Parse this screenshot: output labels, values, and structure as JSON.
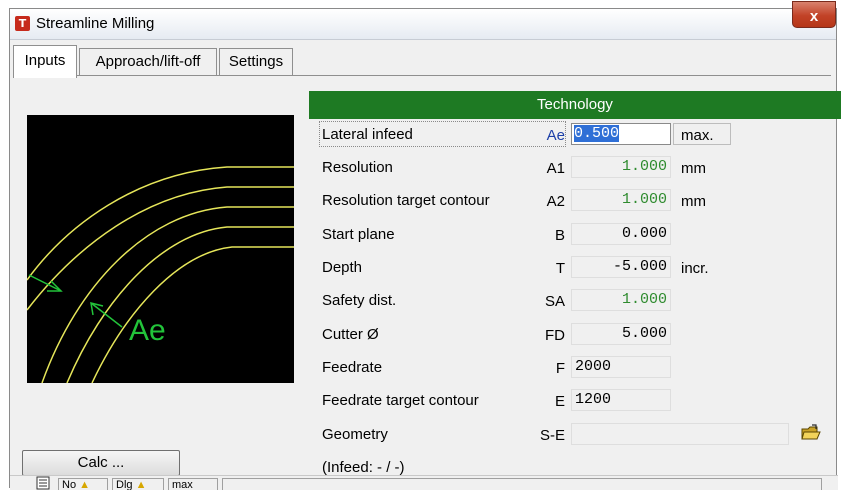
{
  "window": {
    "title": "Streamline Milling",
    "close_label": "x"
  },
  "tabs": [
    {
      "label": "Inputs",
      "active": true
    },
    {
      "label": "Approach/lift-off",
      "active": false
    },
    {
      "label": "Settings",
      "active": false
    }
  ],
  "preview": {
    "label": "Ae"
  },
  "calc_button": "Calc ...",
  "technology": {
    "header": "Technology",
    "rows": [
      {
        "label": "Lateral infeed",
        "symbol": "Ae",
        "value": "0.500",
        "unit": "max."
      },
      {
        "label": "Resolution",
        "symbol": "A1",
        "value": "1.000",
        "unit": "mm"
      },
      {
        "label": "Resolution target contour",
        "symbol": "A2",
        "value": "1.000",
        "unit": "mm"
      },
      {
        "label": "Start plane",
        "symbol": "B",
        "value": "0.000",
        "unit": ""
      },
      {
        "label": "Depth",
        "symbol": "T",
        "value": "-5.000",
        "unit": "incr."
      },
      {
        "label": "Safety dist.",
        "symbol": "SA",
        "value": "1.000",
        "unit": ""
      },
      {
        "label": "Cutter Ø",
        "symbol": "FD",
        "value": "5.000",
        "unit": ""
      },
      {
        "label": "Feedrate",
        "symbol": "F",
        "value": "2000",
        "unit": ""
      },
      {
        "label": "Feedrate target contour",
        "symbol": "E",
        "value": "1200",
        "unit": ""
      },
      {
        "label": "Geometry",
        "symbol": "S-E",
        "value": "",
        "unit": ""
      }
    ],
    "infeed_note": "(Infeed: - / -)"
  },
  "statusbar": {
    "items": [
      "No",
      "Dlg",
      "max"
    ]
  },
  "colors": {
    "header_green": "#1e7a23",
    "value_green": "#2e8b2e",
    "selection_blue": "#2f6fd6",
    "preview_line": "#e6e65a",
    "preview_arrow": "#22c33a"
  },
  "icons": [
    "app-logo-icon",
    "close-icon",
    "folder-open-icon",
    "list-icon",
    "warning-icon"
  ]
}
